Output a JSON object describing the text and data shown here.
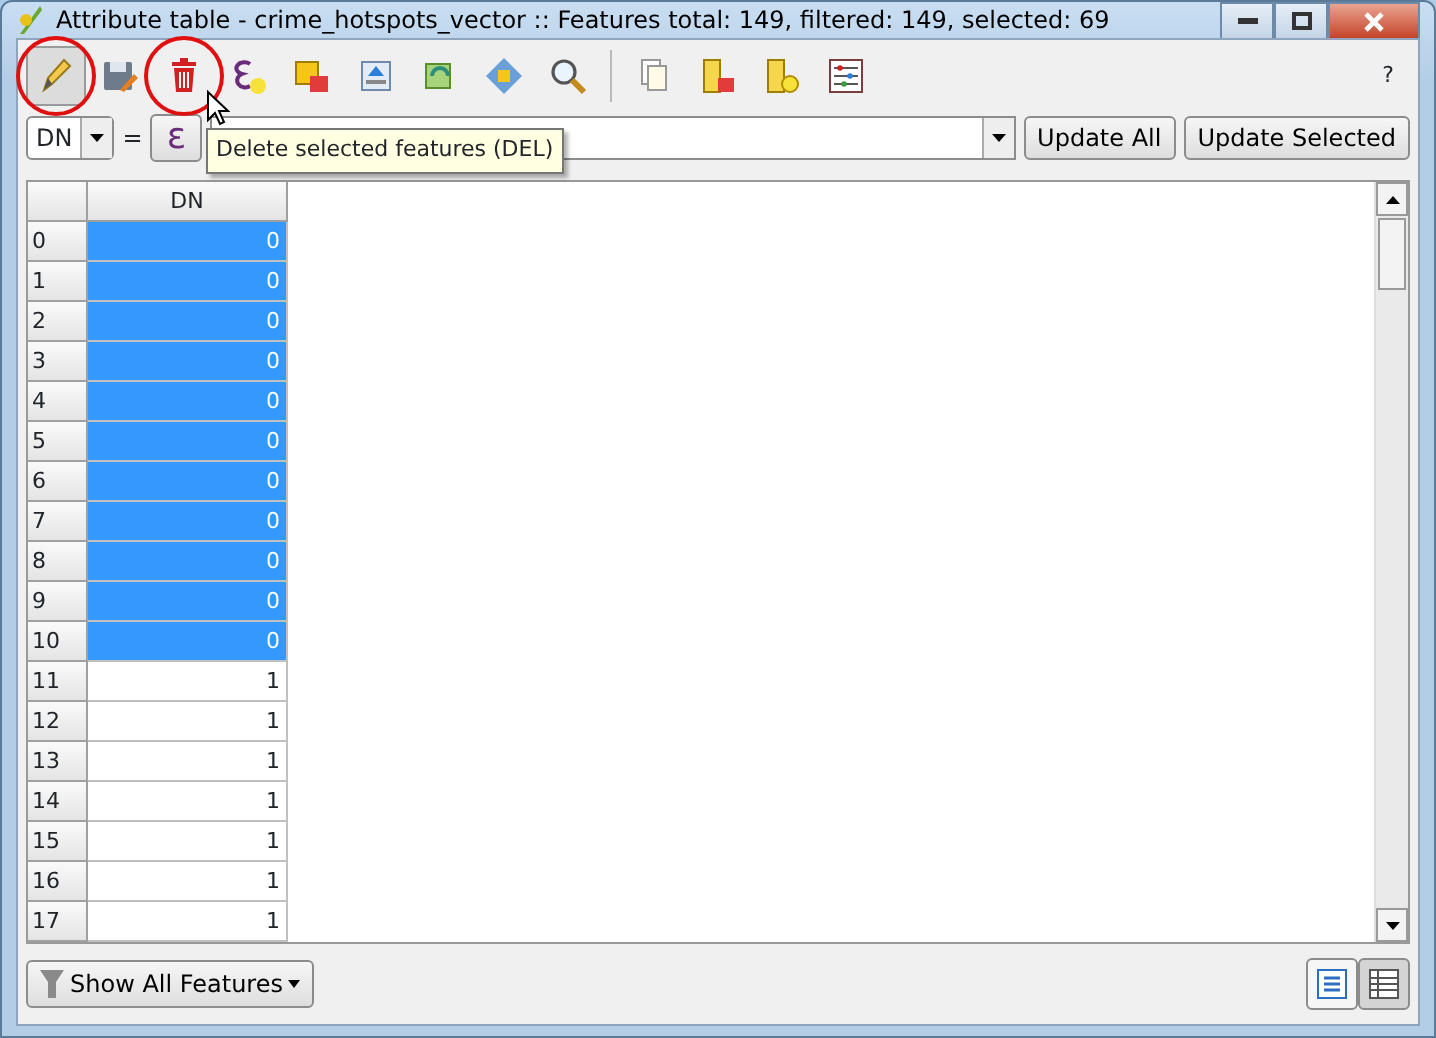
{
  "window": {
    "title": "Attribute table - crime_hotspots_vector :: Features total: 149, filtered: 149, selected: 69"
  },
  "toolbar": [
    {
      "pressed": true,
      "highlighted": true
    },
    {
      "pressed": false,
      "highlighted": false
    },
    {
      "pressed": false,
      "highlighted": true
    },
    {
      "pressed": false,
      "highlighted": false
    },
    {
      "pressed": false,
      "highlighted": false
    },
    {
      "pressed": false,
      "highlighted": false
    },
    {
      "pressed": false,
      "highlighted": false
    },
    {
      "pressed": false,
      "highlighted": false
    },
    {
      "pressed": false,
      "highlighted": false
    },
    {
      "pressed": false,
      "highlighted": false
    },
    {
      "pressed": false,
      "highlighted": false
    },
    {
      "pressed": false,
      "highlighted": false
    },
    {
      "pressed": false,
      "highlighted": false
    }
  ],
  "help_label": "?",
  "field_combo": "DN",
  "equals": "=",
  "expression_button": "ε",
  "update_all": "Update All",
  "update_selected": "Update Selected",
  "tooltip": "Delete selected features (DEL)",
  "table": {
    "columns": [
      "DN"
    ],
    "rows": [
      {
        "header": "0",
        "value": "0",
        "selected": true
      },
      {
        "header": "1",
        "value": "0",
        "selected": true
      },
      {
        "header": "2",
        "value": "0",
        "selected": true
      },
      {
        "header": "3",
        "value": "0",
        "selected": true
      },
      {
        "header": "4",
        "value": "0",
        "selected": true
      },
      {
        "header": "5",
        "value": "0",
        "selected": true
      },
      {
        "header": "6",
        "value": "0",
        "selected": true
      },
      {
        "header": "7",
        "value": "0",
        "selected": true
      },
      {
        "header": "8",
        "value": "0",
        "selected": true
      },
      {
        "header": "9",
        "value": "0",
        "selected": true
      },
      {
        "header": "10",
        "value": "0",
        "selected": true
      },
      {
        "header": "11",
        "value": "1",
        "selected": false
      },
      {
        "header": "12",
        "value": "1",
        "selected": false
      },
      {
        "header": "13",
        "value": "1",
        "selected": false
      },
      {
        "header": "14",
        "value": "1",
        "selected": false
      },
      {
        "header": "15",
        "value": "1",
        "selected": false
      },
      {
        "header": "16",
        "value": "1",
        "selected": false
      },
      {
        "header": "17",
        "value": "1",
        "selected": false
      }
    ]
  },
  "filter_button": "Show All Features",
  "view_modes": [
    {
      "selected": false
    },
    {
      "selected": true
    }
  ]
}
